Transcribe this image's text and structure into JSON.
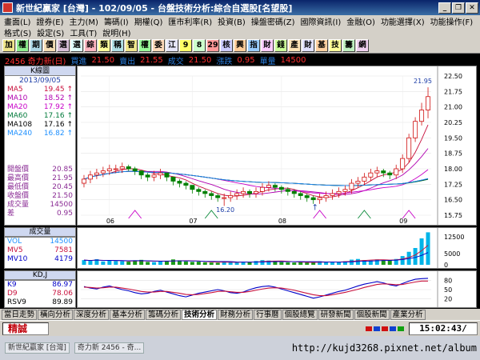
{
  "window": {
    "title": "新世紀贏家 [台灣] - 102/09/05 - 台盤技術分析:綜合自選股[名望股]"
  },
  "menu": {
    "row1": [
      "畫面(L)",
      "證券(E)",
      "主力(M)",
      "籌碼(I)",
      "期權(Q)",
      "匯市利率(R)",
      "投資(B)",
      "操盤密碼(Z)",
      "國際資訊(I)",
      "金融(O)",
      "功能選擇(X)",
      "功能操作(F)"
    ],
    "row2": [
      "格式(S)",
      "設定(S)",
      "工具(T)",
      "說明(H)"
    ]
  },
  "toolbar": [
    "加",
    "權",
    "期",
    "價",
    "選",
    "選",
    "綜",
    "類",
    "稱",
    "智",
    "權",
    "委",
    "江",
    "9",
    "8",
    "29",
    "核",
    "興",
    "指",
    "財",
    "錢",
    "產",
    "財",
    "基",
    "技",
    "籌",
    "網"
  ],
  "quote": {
    "code_name": "2456 奇力新(日)",
    "bid_label": "買進",
    "bid": "21.50",
    "ask_label": "賣出",
    "ask": "21.55",
    "deal_label": "成交",
    "deal": "21.50",
    "change_label": "漲跌",
    "change": "0.95",
    "vol_label": "單量",
    "vol": "13總量",
    "total": "14500"
  },
  "kline": {
    "header": "K線圖",
    "date": "2013/09/05",
    "ma": [
      {
        "name": "MA5",
        "value": "19.45",
        "arrow": "↑",
        "color": "#c8103c"
      },
      {
        "name": "MA10",
        "value": "18.52",
        "arrow": "↑",
        "color": "#b000b0"
      },
      {
        "name": "MA20",
        "value": "17.92",
        "arrow": "↑",
        "color": "#c800c8"
      },
      {
        "name": "MA60",
        "value": "17.16",
        "arrow": "↑",
        "color": "#007a3a"
      },
      {
        "name": "MA108",
        "value": "17.16",
        "arrow": "↑",
        "color": "#000000"
      },
      {
        "name": "MA240",
        "value": "16.82",
        "arrow": "↑",
        "color": "#1e90ff"
      }
    ],
    "prices": [
      {
        "label": "開盤價",
        "value": "20.85"
      },
      {
        "label": "最高價",
        "value": "21.95"
      },
      {
        "label": "最低價",
        "value": "20.45"
      },
      {
        "label": "收盤價",
        "value": "21.50"
      },
      {
        "label": "成交量",
        "value": "14500"
      },
      {
        "label": "差",
        "value": "0.95"
      }
    ]
  },
  "volume_panel": {
    "header": "成交量",
    "rows": [
      {
        "name": "VOL",
        "value": "14500",
        "color": "#1e90ff"
      },
      {
        "name": "MV5",
        "value": "7581",
        "color": "#c8103c"
      },
      {
        "name": "MV10",
        "value": "4179",
        "color": "#0000c8"
      }
    ],
    "axis": [
      "12500",
      "5000",
      "0"
    ]
  },
  "kd_panel": {
    "header": "KD,J",
    "rows": [
      {
        "name": "K9",
        "value": "86.97",
        "color": "#0000c8"
      },
      {
        "name": "D9",
        "value": "78.06",
        "color": "#c8103c"
      },
      {
        "name": "RSV9",
        "value": "89.89",
        "color": "#000000"
      }
    ],
    "axis": [
      "80",
      "50",
      "20"
    ]
  },
  "chart_data": {
    "type": "candlestick",
    "ylim": [
      15.75,
      22.5
    ],
    "y_ticks": [
      "22.50",
      "21.75",
      "21.00",
      "20.25",
      "19.50",
      "18.75",
      "18.00",
      "17.25",
      "16.50",
      "15.75"
    ],
    "x_labels": [
      "06",
      "07",
      "08",
      "09"
    ],
    "annotations": [
      "21.95",
      "16.20"
    ],
    "series": {
      "open": [
        17.3,
        17.5,
        17.7,
        17.8,
        17.9,
        18.0,
        18.0,
        18.1,
        18.0,
        17.9,
        17.7,
        17.6,
        17.7,
        17.8,
        17.6,
        17.4,
        17.3,
        17.2,
        17.0,
        16.9,
        16.8,
        16.7,
        16.6,
        16.6,
        16.7,
        16.8,
        16.9,
        16.8,
        16.9,
        17.1,
        17.2,
        17.1,
        17.0,
        16.9,
        16.8,
        16.7,
        16.6,
        16.5,
        16.6,
        16.7,
        16.8,
        16.9,
        17.0,
        17.3,
        17.4,
        17.6,
        17.8,
        17.9,
        17.8,
        17.7,
        18.0,
        18.5,
        19.5,
        20.3,
        20.85
      ],
      "close": [
        17.5,
        17.7,
        17.8,
        17.9,
        18.0,
        18.0,
        18.1,
        18.0,
        17.9,
        17.7,
        17.6,
        17.7,
        17.8,
        17.6,
        17.4,
        17.3,
        17.2,
        17.0,
        16.9,
        16.8,
        16.7,
        16.6,
        16.6,
        16.7,
        16.8,
        16.9,
        16.8,
        16.9,
        17.1,
        17.2,
        17.1,
        17.0,
        16.9,
        16.8,
        16.7,
        16.6,
        16.5,
        16.6,
        16.7,
        16.8,
        16.9,
        17.0,
        17.3,
        17.4,
        17.6,
        17.8,
        17.9,
        17.8,
        17.7,
        18.0,
        18.5,
        19.5,
        20.3,
        20.85,
        21.5
      ],
      "high": [
        17.7,
        17.9,
        18.0,
        18.1,
        18.2,
        18.2,
        18.3,
        18.2,
        18.1,
        17.9,
        17.8,
        17.9,
        18.0,
        17.8,
        17.6,
        17.5,
        17.4,
        17.2,
        17.1,
        17.0,
        16.9,
        16.8,
        16.8,
        16.9,
        17.0,
        17.1,
        17.0,
        17.1,
        17.3,
        17.4,
        17.3,
        17.2,
        17.1,
        17.0,
        16.9,
        16.8,
        16.7,
        16.8,
        16.9,
        17.0,
        17.1,
        17.2,
        17.5,
        17.6,
        17.8,
        18.0,
        18.1,
        18.0,
        17.9,
        18.2,
        18.7,
        19.7,
        20.5,
        21.2,
        21.95
      ],
      "low": [
        17.1,
        17.3,
        17.5,
        17.6,
        17.7,
        17.8,
        17.8,
        17.9,
        17.7,
        17.5,
        17.4,
        17.4,
        17.5,
        17.4,
        17.2,
        17.1,
        17.0,
        16.8,
        16.7,
        16.6,
        16.5,
        16.4,
        16.2,
        16.4,
        16.5,
        16.6,
        16.6,
        16.6,
        16.7,
        16.9,
        16.9,
        16.8,
        16.7,
        16.6,
        16.5,
        16.4,
        16.3,
        16.3,
        16.4,
        16.5,
        16.6,
        16.7,
        16.8,
        17.1,
        17.2,
        17.4,
        17.6,
        17.6,
        17.5,
        17.5,
        17.8,
        18.3,
        19.3,
        20.1,
        20.45
      ],
      "volume": [
        2100,
        1800,
        2500,
        1500,
        1900,
        1700,
        1600,
        1400,
        2000,
        2200,
        1300,
        1200,
        1600,
        1800,
        2400,
        2000,
        1500,
        1300,
        1400,
        1100,
        1000,
        900,
        1500,
        1200,
        1000,
        1300,
        1100,
        1700,
        2100,
        1900,
        1600,
        1200,
        1100,
        1000,
        1300,
        1000,
        900,
        1600,
        1200,
        1400,
        1100,
        1600,
        2300,
        2600,
        2100,
        1900,
        2400,
        2200,
        2000,
        2600,
        3900,
        5800,
        7500,
        11800,
        14500
      ],
      "kd_k": [
        60,
        55,
        52,
        58,
        62,
        56,
        50,
        46,
        40,
        36,
        38,
        44,
        48,
        42,
        36,
        30,
        26,
        32,
        38,
        42,
        46,
        50,
        46,
        40,
        38,
        42,
        50,
        56,
        60,
        62,
        58,
        52,
        46,
        40,
        34,
        28,
        22,
        26,
        32,
        38,
        44,
        48,
        55,
        62,
        68,
        72,
        76,
        72,
        66,
        62,
        70,
        78,
        84,
        86,
        86.97
      ],
      "kd_d": [
        58,
        57,
        55,
        56,
        58,
        58,
        55,
        52,
        48,
        44,
        42,
        42,
        44,
        44,
        41,
        38,
        34,
        33,
        34,
        37,
        40,
        44,
        45,
        43,
        41,
        41,
        44,
        48,
        52,
        55,
        56,
        55,
        52,
        48,
        43,
        38,
        33,
        30,
        30,
        33,
        37,
        41,
        46,
        51,
        57,
        62,
        67,
        69,
        68,
        66,
        67,
        71,
        75,
        78,
        78.06
      ]
    }
  },
  "tabs": [
    "當日走勢",
    "橫向分析",
    "深度分析",
    "基本分析",
    "籌碼分析",
    "技術分析",
    "財務分析",
    "行事曆",
    "個股總覽",
    "研發新聞",
    "個股新聞",
    "產業分析"
  ],
  "active_tab": "技術分析",
  "status": {
    "left": "精誠",
    "time": "15:02:43/"
  },
  "taskbar": {
    "items": [
      "新世紀贏家 [台灣]",
      "奇力新 2456 - 奇..."
    ],
    "url": "http://kujd3268.pixnet.net/album"
  }
}
